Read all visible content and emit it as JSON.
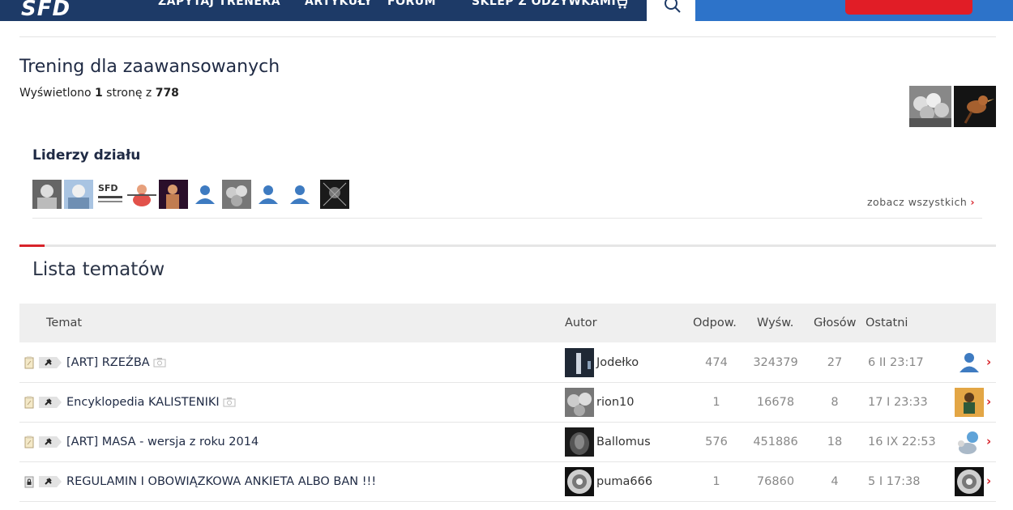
{
  "nav": {
    "logo": "SFD",
    "links": [
      "ZAPYTAJ TRENERA",
      "ARTYKUŁY",
      "FORUM",
      "SKLEP Z ODŻYWKAMI"
    ]
  },
  "page": {
    "title": "Trening dla zaawansowanych",
    "info_prefix": "Wyświetlono ",
    "info_page": "1",
    "info_mid": " stronę z ",
    "info_total": "778"
  },
  "leaders": {
    "title": "Liderzy działu",
    "see_all": "zobacz wszystkich",
    "chevron": "›"
  },
  "topics": {
    "title": "Lista tematów",
    "headers": {
      "topic": "Temat",
      "author": "Autor",
      "replies": "Odpow.",
      "views": "Wyśw.",
      "votes": "Głosów",
      "last": "Ostatni"
    },
    "rows": [
      {
        "title": "[ART] RZEŹBA",
        "author": "Jodełko",
        "replies": "474",
        "views": "324379",
        "votes": "27",
        "last": "6 II 23:17"
      },
      {
        "title": "Encyklopedia KALISTENIKI",
        "author": "rion10",
        "replies": "1",
        "views": "16678",
        "votes": "8",
        "last": "17 I 23:33"
      },
      {
        "title": "[ART] MASA - wersja z roku 2014",
        "author": "Ballomus",
        "replies": "576",
        "views": "451886",
        "votes": "18",
        "last": "16 IX 22:53"
      },
      {
        "title": "REGULAMIN I OBOWIĄZKOWA ANKIETA ALBO BAN !!!",
        "author": "puma666",
        "replies": "1",
        "views": "76860",
        "votes": "4",
        "last": "5 I 17:38"
      }
    ],
    "chevron": "›"
  },
  "colors": {
    "nav_bg": "#1d3a67",
    "accent_red": "#d8232a",
    "accent_blue": "#2d73c9"
  }
}
